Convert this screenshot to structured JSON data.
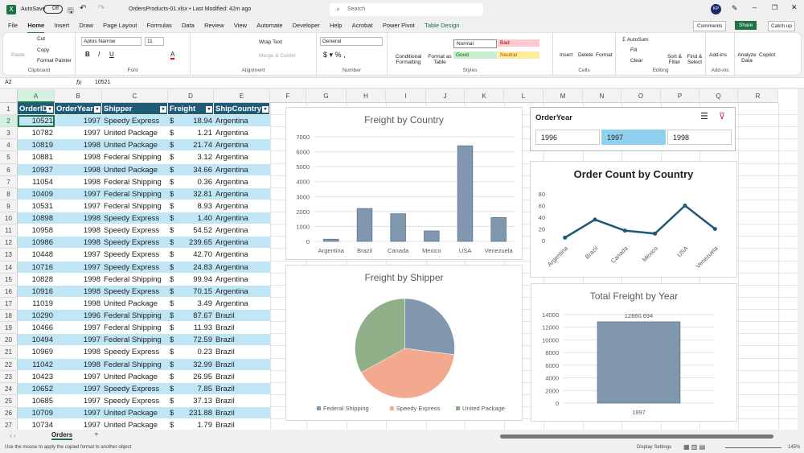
{
  "titlebar": {
    "autosave": "AutoSave",
    "autosave_state": "Off",
    "filename": "OrdersProducts-01.xlsx • Last Modified: 42m ago",
    "search_placeholder": "Search",
    "avatar": "KP"
  },
  "tabs": [
    "File",
    "Home",
    "Insert",
    "Draw",
    "Page Layout",
    "Formulas",
    "Data",
    "Review",
    "View",
    "Automate",
    "Developer",
    "Help",
    "Acrobat",
    "Power Pivot",
    "Table Design"
  ],
  "actions": {
    "comments": "Comments",
    "share": "Share",
    "catchup": "Catch up"
  },
  "ribbon": {
    "paste": "Paste",
    "cut": "Cut",
    "copy": "Copy",
    "format_painter": "Format Painter",
    "clipboard": "Clipboard",
    "font_name": "Aptos Narrow",
    "font_size": "11",
    "font": "Font",
    "wrap": "Wrap Text",
    "merge": "Merge & Center",
    "alignment": "Alignment",
    "number_format": "General",
    "number": "Number",
    "cond": "Conditional Formatting",
    "fmt_table": "Format as Table",
    "normal": "Normal",
    "bad": "Bad",
    "good": "Good",
    "neutral": "Neutral",
    "styles": "Styles",
    "insert": "Insert",
    "delete": "Delete",
    "format": "Format",
    "cells": "Cells",
    "autosum": "AutoSum",
    "fill": "Fill",
    "clear": "Clear",
    "sort": "Sort & Filter",
    "find": "Find & Select",
    "editing": "Editing",
    "addins": "Add-ins",
    "addins_grp": "Add-ins",
    "analyze": "Analyze Data",
    "copilot": "Copilot"
  },
  "formula": {
    "namebox": "A2",
    "value": "10521"
  },
  "columns": [
    "A",
    "B",
    "C",
    "D",
    "E",
    "F",
    "G",
    "H",
    "I",
    "J",
    "K",
    "L",
    "M",
    "N",
    "O",
    "P",
    "Q",
    "R"
  ],
  "table": {
    "headers": [
      "OrderID",
      "OrderYear",
      "Shipper",
      "Freight",
      "ShipCountry"
    ],
    "rows": [
      [
        "10521",
        "1997",
        "Speedy Express",
        "$",
        "18.94",
        "Argentina"
      ],
      [
        "10782",
        "1997",
        "United Package",
        "$",
        "1.21",
        "Argentina"
      ],
      [
        "10819",
        "1998",
        "United Package",
        "$",
        "21.74",
        "Argentina"
      ],
      [
        "10881",
        "1998",
        "Federal Shipping",
        "$",
        "3.12",
        "Argentina"
      ],
      [
        "10937",
        "1998",
        "United Package",
        "$",
        "34.66",
        "Argentina"
      ],
      [
        "11054",
        "1998",
        "Federal Shipping",
        "$",
        "0.36",
        "Argentina"
      ],
      [
        "10409",
        "1997",
        "Federal Shipping",
        "$",
        "32.81",
        "Argentina"
      ],
      [
        "10531",
        "1997",
        "Federal Shipping",
        "$",
        "8.93",
        "Argentina"
      ],
      [
        "10898",
        "1998",
        "Speedy Express",
        "$",
        "1.40",
        "Argentina"
      ],
      [
        "10958",
        "1998",
        "Speedy Express",
        "$",
        "54.52",
        "Argentina"
      ],
      [
        "10986",
        "1998",
        "Speedy Express",
        "$",
        "239.65",
        "Argentina"
      ],
      [
        "10448",
        "1997",
        "Speedy Express",
        "$",
        "42.70",
        "Argentina"
      ],
      [
        "10716",
        "1997",
        "Speedy Express",
        "$",
        "24.83",
        "Argentina"
      ],
      [
        "10828",
        "1998",
        "Federal Shipping",
        "$",
        "99.94",
        "Argentina"
      ],
      [
        "10916",
        "1998",
        "Speedy Express",
        "$",
        "70.15",
        "Argentina"
      ],
      [
        "11019",
        "1998",
        "United Package",
        "$",
        "3.49",
        "Argentina"
      ],
      [
        "10290",
        "1996",
        "Federal Shipping",
        "$",
        "87.67",
        "Brazil"
      ],
      [
        "10466",
        "1997",
        "Federal Shipping",
        "$",
        "11.93",
        "Brazil"
      ],
      [
        "10494",
        "1997",
        "Federal Shipping",
        "$",
        "72.59",
        "Brazil"
      ],
      [
        "10969",
        "1998",
        "Speedy Express",
        "$",
        "0.23",
        "Brazil"
      ],
      [
        "11042",
        "1998",
        "Federal Shipping",
        "$",
        "32.99",
        "Brazil"
      ],
      [
        "10423",
        "1997",
        "United Package",
        "$",
        "26.95",
        "Brazil"
      ],
      [
        "10652",
        "1997",
        "Speedy Express",
        "$",
        "7.85",
        "Brazil"
      ],
      [
        "10685",
        "1997",
        "Speedy Express",
        "$",
        "37.13",
        "Brazil"
      ],
      [
        "10709",
        "1997",
        "United Package",
        "$",
        "231.88",
        "Brazil"
      ],
      [
        "10734",
        "1997",
        "United Package",
        "$",
        "1.79",
        "Brazil"
      ]
    ]
  },
  "slicer": {
    "title": "OrderYear",
    "items": [
      "1996",
      "1997",
      "1998"
    ],
    "selected": "1997"
  },
  "chart_data": [
    {
      "type": "bar",
      "title": "Freight by Country",
      "categories": [
        "Argentina",
        "Brazil",
        "Canada",
        "Mexico",
        "USA",
        "Venezuela"
      ],
      "values": [
        150,
        2200,
        1850,
        700,
        6400,
        1600
      ],
      "ylim": [
        0,
        7000
      ],
      "yticks": [
        "0",
        "1000",
        "2000",
        "3000",
        "4000",
        "5000",
        "6000",
        "7000"
      ],
      "color": "#8097ae"
    },
    {
      "type": "pie",
      "title": "Freight by Shipper",
      "categories": [
        "Federal Shipping",
        "Speedy Express",
        "United Package"
      ],
      "values": [
        27,
        40,
        33
      ],
      "colors": [
        "#8097ae",
        "#f2a98e",
        "#8faf88"
      ]
    },
    {
      "type": "line",
      "title": "Order Count by Country",
      "categories": [
        "Argentina",
        "Brazil",
        "Canada",
        "Mexico",
        "USA",
        "Venezuela"
      ],
      "values": [
        5,
        36,
        17,
        12,
        60,
        20
      ],
      "ylim": [
        0,
        80
      ],
      "yticks": [
        "0",
        "20",
        "40",
        "60",
        "80"
      ],
      "color": "#1e5a73"
    },
    {
      "type": "bar",
      "title": "Total Freight by Year",
      "categories": [
        "1997"
      ],
      "values": [
        12860.694
      ],
      "labels": [
        "12860.694"
      ],
      "ylim": [
        0,
        14000
      ],
      "yticks": [
        "0",
        "2000",
        "4000",
        "6000",
        "8000",
        "10000",
        "12000",
        "14000"
      ],
      "color": "#8097ae"
    }
  ],
  "sheet": {
    "tab": "Orders",
    "add": "+"
  },
  "status": {
    "message": "Use the mouse to apply the copied format to another object",
    "display": "Display Settings",
    "zoom": "145%"
  }
}
